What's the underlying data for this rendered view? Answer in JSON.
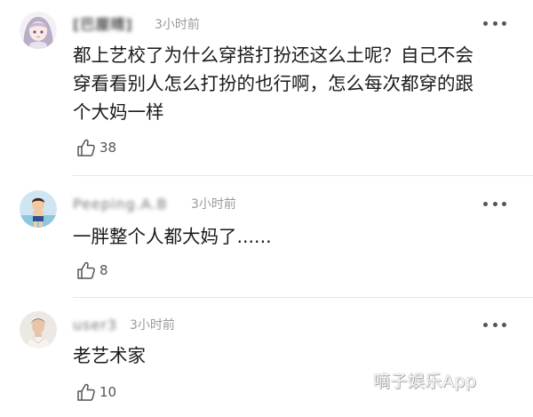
{
  "comments": [
    {
      "username": "[巴厘晴]",
      "time": "3小时前",
      "text": "都上艺校了为什么穿搭打扮还这么土呢？自己不会\n穿看看别人怎么打扮的也行啊，怎么每次都穿的跟\n个大妈一样",
      "likes": "38"
    },
    {
      "username": "Peeping.A.B",
      "time": "3小时前",
      "text": "一胖整个人都大妈了......",
      "likes": "8"
    },
    {
      "username": "user3",
      "time": "3小时前",
      "text": "老艺术家",
      "likes": "10"
    }
  ],
  "icons": {
    "like": "thumbs-up-outline-icon",
    "more": "more-dots-icon"
  },
  "watermark": "嘀子娱乐App"
}
